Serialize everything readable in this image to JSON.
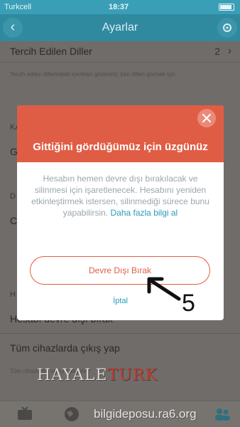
{
  "status_bar": {
    "carrier": "Turkcell",
    "time": "18:37"
  },
  "nav": {
    "title": "Ayarlar"
  },
  "settings": {
    "preferred_languages_label": "Tercih Edilen Diller",
    "preferred_languages_count": "2",
    "preferred_languages_note": "Tercih edilen dillerindeki içerikleri gösteririz; tüm dilleri görmek için",
    "section_k": "KA",
    "row_g": "G",
    "section_d": "D",
    "row_c": "C",
    "section_h": "H",
    "deactivate_row": "Hesabı devre dışı bırak",
    "logout_all_row": "Tüm cihazlarda çıkış yap",
    "logout_note": "Tüm cihazlarda oturum kapatılır"
  },
  "dialog": {
    "title": "Gittiğini gördüğümüz için üzgünüz",
    "body": "Hesabın hemen devre dışı bırakılacak ve silinmesi için işaretlenecek. Hesabını yeniden etkinleştirmek istersen, silinmediği sürece bunu yapabilirsin.",
    "link": "Daha fazla bilgi al",
    "primary_button": "Devre Dışı Bırak",
    "cancel": "İptal"
  },
  "annotation": {
    "step": "5"
  },
  "watermarks": {
    "logo_main": "HAYALE",
    "logo_accent": "TURK",
    "site": "bilgidepos u.ra6.org"
  },
  "colors": {
    "header": "#e05d45",
    "link": "#2a9bbb",
    "nav": "#2f8aa0"
  }
}
